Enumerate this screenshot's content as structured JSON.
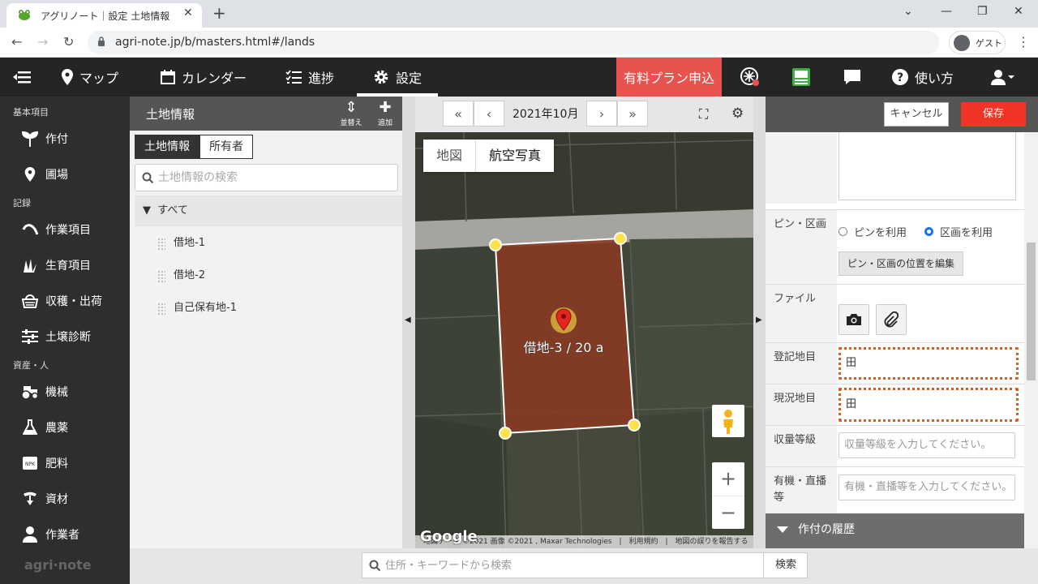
{
  "browser": {
    "tab_title": "アグリノート｜設定 土地情報",
    "url": "agri-note.jp/b/masters.html#/lands",
    "profile_label": "ゲスト"
  },
  "header": {
    "map": "マップ",
    "calendar": "カレンダー",
    "progress": "進捗",
    "settings": "設定",
    "upgrade": "有料プラン申込",
    "help": "使い方"
  },
  "sidebar": {
    "group_basic": "基本項目",
    "group_record": "記録",
    "group_assets": "資産・人",
    "items": {
      "crop": "作付",
      "field": "圃場",
      "work_item": "作業項目",
      "growth_item": "生育項目",
      "harvest": "収穫・出荷",
      "soil": "土壌診断",
      "machine": "機械",
      "pesticide": "農薬",
      "fertilizer": "肥料",
      "material": "資材",
      "worker": "作業者"
    },
    "npk_icon_text": "NPK",
    "brand": "agri·note"
  },
  "list_panel": {
    "title": "土地情報",
    "sort_label": "並替え",
    "add_label": "追加",
    "tab_land": "土地情報",
    "tab_owner": "所有者",
    "search_placeholder": "土地情報の検索",
    "all_label": "すべて",
    "items": [
      "借地-1",
      "借地-2",
      "自己保有地-1"
    ]
  },
  "map": {
    "month": "2021年10月",
    "type_map": "地図",
    "type_aerial": "航空写真",
    "parcel_label": "借地-3 / 20 a",
    "google": "Google",
    "attribution": "地図データ ©2021 画像 ©2021 , Maxar Technologies　|　利用規約　|　地図の誤りを報告する"
  },
  "form": {
    "cancel": "キャンセル",
    "save": "保存",
    "pin_label": "ピン・区画",
    "pin_option": "ピンを利用",
    "area_option": "区画を利用",
    "selected_option": "区画を利用",
    "edit_pin_button": "ピン・区画の位置を編集",
    "file_label": "ファイル",
    "registered_type_label": "登記地目",
    "registered_type_value": "田",
    "current_type_label": "現況地目",
    "current_type_value": "田",
    "yield_grade_label": "収量等級",
    "yield_grade_placeholder": "収量等級を入力してください。",
    "organic_label": "有機・直播等",
    "organic_placeholder": "有機・直播等を入力してください。",
    "crop_history": "作付の履歴"
  },
  "bottom_search": {
    "placeholder": "住所・キーワードから検索",
    "button": "検索"
  },
  "colors": {
    "header_bg": "#252525",
    "upgrade_bg": "#e8534f",
    "save_bg": "#f03426",
    "parcel_fill": "#8a3a22",
    "highlight_border": "#e05a1c"
  }
}
